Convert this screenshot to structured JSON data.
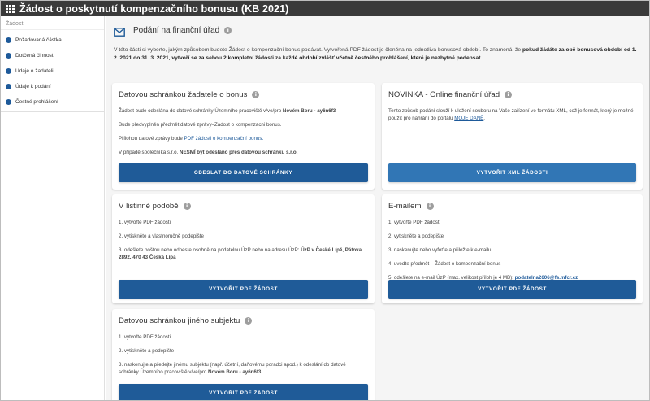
{
  "app": {
    "title": "Žádost o poskytnutí kompenzačního bonusu (KB 2021)"
  },
  "sidebar": {
    "group": "Žádost",
    "items": [
      {
        "label": "Požadovaná částka"
      },
      {
        "label": "Dotčená činnost"
      },
      {
        "label": "Údaje o žadateli"
      },
      {
        "label": "Údaje k podání"
      },
      {
        "label": "Čestné prohlášení"
      }
    ]
  },
  "section": {
    "title": "Podání na finanční úřad",
    "intro_1": "V této části si vyberte, jakým způsobem budete Žádost o kompenzační bonus podávat. Vytvořená PDF žádost je členěna na jednotlivá bonusová období. To znamená, že ",
    "intro_bold": "pokud žádáte za obě bonusová období od 1. 2. 2021 do 31. 3. 2021, vytvoří se za sebou 2 kompletní žádosti za každé období zvlášť včetně čestného prohlášení, které je nezbytné podepsat."
  },
  "cards": {
    "ds": {
      "title": "Datovou schránkou žadatele o bonus",
      "l1a": "Žádost bude odeslána do datové schránky Územního pracoviště v/ve/pro ",
      "l1b": "Novém Boru - ay6n6f3",
      "l2": "Bude předvyplněn předmět datové zprávy–Zadost o kompenzacni bonus.",
      "l3a": "Přílohou datové zprávy bude ",
      "l3b": "PDF žádosti o kompenzační bonus.",
      "l4a": "V případě společníka s.r.o. ",
      "l4b": "NESMÍ být odesláno přes datovou schránku s.r.o.",
      "button": "Odeslat do datové schránky"
    },
    "online": {
      "title": "NOVINKA - Online finanční úřad",
      "text": "Tento způsob podání slouží k uložení souboru na Vaše zařízení ve formátu XML, což je formát, který je možné použít pro nahrání do portálu ",
      "link": "MOJE DANĚ",
      "text_end": ".",
      "button": "Vytvořit XML žádosti"
    },
    "paper": {
      "title": "V listinné podobě",
      "l1": "1. vytvořte PDF žádosti",
      "l2": "2. vytiskněte a vlastnoručně podepište",
      "l3a": "3. odešlete poštou nebo odneste osobně na podatelnu ÚzP nebo na adresu ÚzP: ",
      "l3b": "ÚzP v České Lípě, Pátova 2892, 470 43 Česká Lípa",
      "button": "Vytvořit PDF žádost"
    },
    "email": {
      "title": "E-mailem",
      "l1": "1. vytvořte PDF žádosti",
      "l2": "2. vytiskněte a podepište",
      "l3": "3. naskenujte nebo vyfoťte a přiložte k e-mailu",
      "l4": "4. uveďte předmět – Žádost o kompenzační bonus",
      "l5a": "5. odešlete na e-mail ÚzP (max. velikost příloh je 4 MB): ",
      "l5b": "podatelna2606@fs.mfcr.cz",
      "button": "Vytvořit PDF žádost"
    },
    "other": {
      "title": "Datovou schránkou jiného subjektu",
      "l1": "1. vytvořte PDF žádosti",
      "l2": "2. vytiskněte a podepište",
      "l3a": "3. naskenujte a předejte jinému subjektu (např. účetní, daňovému poradci apod.) k odeslání do datové schránky Územního pracoviště v/ve/pro ",
      "l3b": "Novém Boru - ay6n6f3",
      "button": "Vytvořit PDF žádost"
    }
  },
  "colors": {
    "appbar": "#3a3a3a",
    "primary": "#1f5b98",
    "online_button": "#3176b5",
    "background": "#f5f5f5"
  }
}
